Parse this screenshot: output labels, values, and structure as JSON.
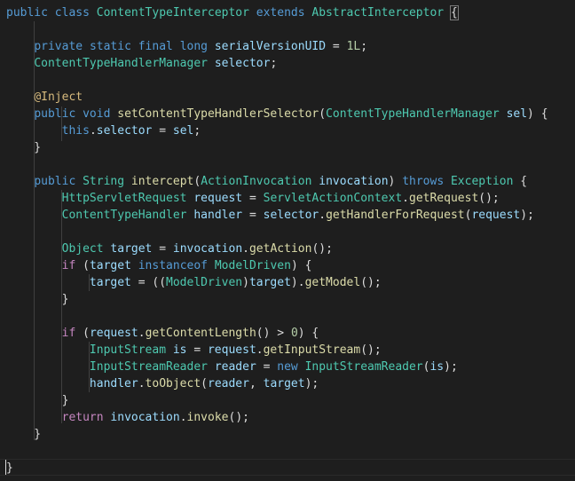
{
  "theme": {
    "background": "#1e1e1e",
    "keyword": "#569cd6",
    "type": "#4ec9b0",
    "method": "#dcdcaa",
    "variable": "#9cdcfe",
    "number": "#b5cea8",
    "annotation": "#d7ba7d",
    "control": "#c586c0",
    "plain": "#dcdcdc"
  },
  "lines": [
    [
      [
        "kw",
        "public"
      ],
      [
        "tx",
        " "
      ],
      [
        "kw",
        "class"
      ],
      [
        "tx",
        " "
      ],
      [
        "ty",
        "ContentTypeInterceptor"
      ],
      [
        "tx",
        " "
      ],
      [
        "kw",
        "extends"
      ],
      [
        "tx",
        " "
      ],
      [
        "ty",
        "AbstractInterceptor"
      ],
      [
        "tx",
        " "
      ],
      [
        "tx",
        "{"
      ]
    ],
    [],
    [
      [
        "tx",
        "    "
      ],
      [
        "kw",
        "private"
      ],
      [
        "tx",
        " "
      ],
      [
        "kw",
        "static"
      ],
      [
        "tx",
        " "
      ],
      [
        "kw",
        "final"
      ],
      [
        "tx",
        " "
      ],
      [
        "kw",
        "long"
      ],
      [
        "tx",
        " "
      ],
      [
        "va",
        "serialVersionUID"
      ],
      [
        "tx",
        " = "
      ],
      [
        "nu",
        "1L"
      ],
      [
        "tx",
        ";"
      ]
    ],
    [
      [
        "tx",
        "    "
      ],
      [
        "ty",
        "ContentTypeHandlerManager"
      ],
      [
        "tx",
        " "
      ],
      [
        "va",
        "selector"
      ],
      [
        "tx",
        ";"
      ]
    ],
    [],
    [
      [
        "tx",
        "    "
      ],
      [
        "an",
        "@Inject"
      ]
    ],
    [
      [
        "tx",
        "    "
      ],
      [
        "kw",
        "public"
      ],
      [
        "tx",
        " "
      ],
      [
        "kw",
        "void"
      ],
      [
        "tx",
        " "
      ],
      [
        "fn",
        "setContentTypeHandlerSelector"
      ],
      [
        "tx",
        "("
      ],
      [
        "ty",
        "ContentTypeHandlerManager"
      ],
      [
        "tx",
        " "
      ],
      [
        "va",
        "sel"
      ],
      [
        "tx",
        ") {"
      ]
    ],
    [
      [
        "tx",
        "        "
      ],
      [
        "kw",
        "this"
      ],
      [
        "tx",
        "."
      ],
      [
        "va",
        "selector"
      ],
      [
        "tx",
        " = "
      ],
      [
        "va",
        "sel"
      ],
      [
        "tx",
        ";"
      ]
    ],
    [
      [
        "tx",
        "    }"
      ]
    ],
    [],
    [
      [
        "tx",
        "    "
      ],
      [
        "kw",
        "public"
      ],
      [
        "tx",
        " "
      ],
      [
        "ty",
        "String"
      ],
      [
        "tx",
        " "
      ],
      [
        "fn",
        "intercept"
      ],
      [
        "tx",
        "("
      ],
      [
        "ty",
        "ActionInvocation"
      ],
      [
        "tx",
        " "
      ],
      [
        "va",
        "invocation"
      ],
      [
        "tx",
        ") "
      ],
      [
        "kw",
        "throws"
      ],
      [
        "tx",
        " "
      ],
      [
        "ty",
        "Exception"
      ],
      [
        "tx",
        " {"
      ]
    ],
    [
      [
        "tx",
        "        "
      ],
      [
        "ty",
        "HttpServletRequest"
      ],
      [
        "tx",
        " "
      ],
      [
        "va",
        "request"
      ],
      [
        "tx",
        " = "
      ],
      [
        "ty",
        "ServletActionContext"
      ],
      [
        "tx",
        "."
      ],
      [
        "fn",
        "getRequest"
      ],
      [
        "tx",
        "();"
      ]
    ],
    [
      [
        "tx",
        "        "
      ],
      [
        "ty",
        "ContentTypeHandler"
      ],
      [
        "tx",
        " "
      ],
      [
        "va",
        "handler"
      ],
      [
        "tx",
        " = "
      ],
      [
        "va",
        "selector"
      ],
      [
        "tx",
        "."
      ],
      [
        "fn",
        "getHandlerForRequest"
      ],
      [
        "tx",
        "("
      ],
      [
        "va",
        "request"
      ],
      [
        "tx",
        ");"
      ]
    ],
    [],
    [
      [
        "tx",
        "        "
      ],
      [
        "ty",
        "Object"
      ],
      [
        "tx",
        " "
      ],
      [
        "va",
        "target"
      ],
      [
        "tx",
        " = "
      ],
      [
        "va",
        "invocation"
      ],
      [
        "tx",
        "."
      ],
      [
        "fn",
        "getAction"
      ],
      [
        "tx",
        "();"
      ]
    ],
    [
      [
        "tx",
        "        "
      ],
      [
        "ct",
        "if"
      ],
      [
        "tx",
        " ("
      ],
      [
        "va",
        "target"
      ],
      [
        "tx",
        " "
      ],
      [
        "kw",
        "instanceof"
      ],
      [
        "tx",
        " "
      ],
      [
        "ty",
        "ModelDriven"
      ],
      [
        "tx",
        ") {"
      ]
    ],
    [
      [
        "tx",
        "            "
      ],
      [
        "va",
        "target"
      ],
      [
        "tx",
        " = (("
      ],
      [
        "ty",
        "ModelDriven"
      ],
      [
        "tx",
        ")"
      ],
      [
        "va",
        "target"
      ],
      [
        "tx",
        ")."
      ],
      [
        "fn",
        "getModel"
      ],
      [
        "tx",
        "();"
      ]
    ],
    [
      [
        "tx",
        "        }"
      ]
    ],
    [],
    [
      [
        "tx",
        "        "
      ],
      [
        "ct",
        "if"
      ],
      [
        "tx",
        " ("
      ],
      [
        "va",
        "request"
      ],
      [
        "tx",
        "."
      ],
      [
        "fn",
        "getContentLength"
      ],
      [
        "tx",
        "() > "
      ],
      [
        "nu",
        "0"
      ],
      [
        "tx",
        ") {"
      ]
    ],
    [
      [
        "tx",
        "            "
      ],
      [
        "ty",
        "InputStream"
      ],
      [
        "tx",
        " "
      ],
      [
        "va",
        "is"
      ],
      [
        "tx",
        " = "
      ],
      [
        "va",
        "request"
      ],
      [
        "tx",
        "."
      ],
      [
        "fn",
        "getInputStream"
      ],
      [
        "tx",
        "();"
      ]
    ],
    [
      [
        "tx",
        "            "
      ],
      [
        "ty",
        "InputStreamReader"
      ],
      [
        "tx",
        " "
      ],
      [
        "va",
        "reader"
      ],
      [
        "tx",
        " = "
      ],
      [
        "kw",
        "new"
      ],
      [
        "tx",
        " "
      ],
      [
        "ty",
        "InputStreamReader"
      ],
      [
        "tx",
        "("
      ],
      [
        "va",
        "is"
      ],
      [
        "tx",
        ");"
      ]
    ],
    [
      [
        "tx",
        "            "
      ],
      [
        "va",
        "handler"
      ],
      [
        "tx",
        "."
      ],
      [
        "fn",
        "toObject"
      ],
      [
        "tx",
        "("
      ],
      [
        "va",
        "reader"
      ],
      [
        "tx",
        ", "
      ],
      [
        "va",
        "target"
      ],
      [
        "tx",
        ");"
      ]
    ],
    [
      [
        "tx",
        "        }"
      ]
    ],
    [
      [
        "tx",
        "        "
      ],
      [
        "ct",
        "return"
      ],
      [
        "tx",
        " "
      ],
      [
        "va",
        "invocation"
      ],
      [
        "tx",
        "."
      ],
      [
        "fn",
        "invoke"
      ],
      [
        "tx",
        "();"
      ]
    ],
    [
      [
        "tx",
        "    }"
      ]
    ],
    [],
    [
      [
        "tx",
        "}"
      ]
    ]
  ]
}
